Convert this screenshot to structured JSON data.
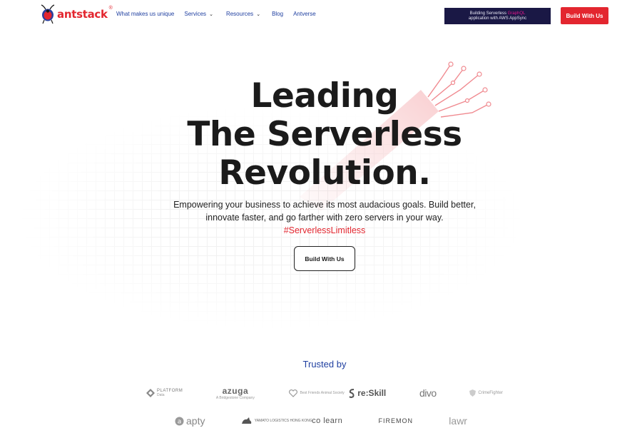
{
  "brand": {
    "name": "antstack",
    "reg": "®"
  },
  "nav": {
    "items": [
      {
        "label": "What makes us unique",
        "has_dropdown": false
      },
      {
        "label": "Services",
        "has_dropdown": true
      },
      {
        "label": "Resources",
        "has_dropdown": true
      },
      {
        "label": "Blog",
        "has_dropdown": false
      },
      {
        "label": "Antverse",
        "has_dropdown": false
      }
    ]
  },
  "promo": {
    "line1_prefix": "Building Serverless ",
    "line1_highlight": "GraphQL",
    "line2": "application with AWS AppSync"
  },
  "header_cta": {
    "label": "Build With Us"
  },
  "hero": {
    "title_lines": [
      "Leading",
      "The Serverless",
      "Revolution."
    ],
    "subtitle": "Empowering your business to achieve its most audacious goals. Build better, innovate faster, and go farther with zero servers in your way.",
    "hashtag": "#ServerlessLimitless",
    "cta": "Build With Us"
  },
  "trusted": {
    "heading": "Trusted by",
    "row1": [
      {
        "name": "PLATFORM",
        "sub": "Data"
      },
      {
        "name": "azuga",
        "sub": "A Bridgestone Company"
      },
      {
        "name": "Best Friends Animal Society",
        "sub": ""
      },
      {
        "name": "re:Skill",
        "sub": ""
      },
      {
        "name": "divo",
        "sub": ""
      },
      {
        "name": "CrimeFighter",
        "sub": ""
      }
    ],
    "row2": [
      {
        "name": "apty",
        "sub": ""
      },
      {
        "name": "YAMATO LOGISTICS HONG KONG",
        "sub": ""
      },
      {
        "name": "co learn",
        "sub": ""
      },
      {
        "name": "FIREMON",
        "sub": ""
      },
      {
        "name": "lawr",
        "sub": ""
      }
    ]
  },
  "colors": {
    "accent": "#e3262f",
    "nav_link": "#1f3fa0",
    "promo_bg": "#1a1845",
    "promo_highlight": "#e3168a",
    "text_dark": "#1b1b1b"
  }
}
